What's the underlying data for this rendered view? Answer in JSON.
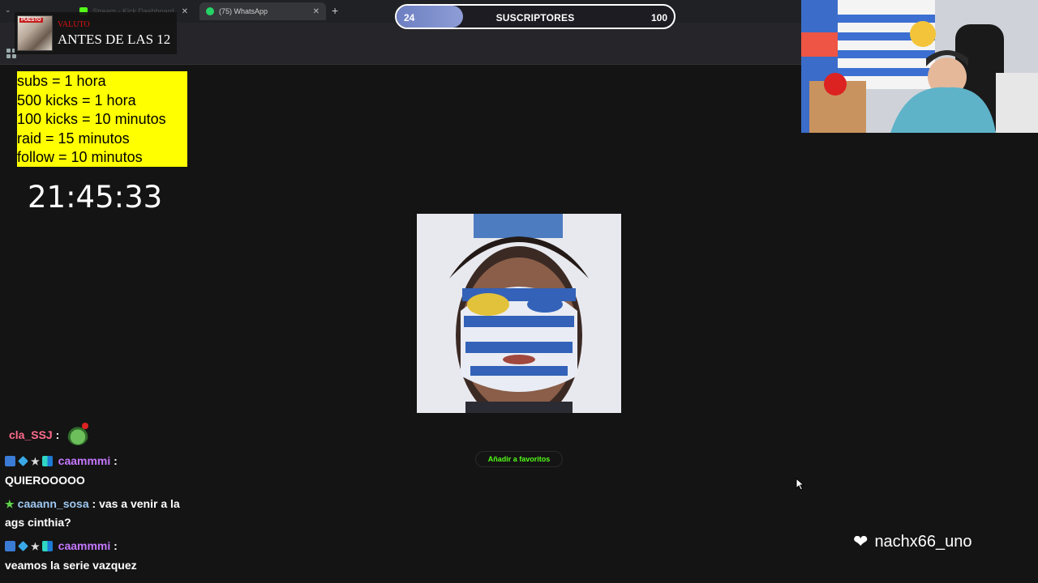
{
  "browser": {
    "tabs": [
      {
        "label": "Stream - Kick Dashboard"
      },
      {
        "label": "(75) WhatsApp"
      }
    ],
    "new_tab": "+"
  },
  "now_playing": {
    "album_badge": "PUESTO",
    "artist": "VALUTO",
    "song": "ANTES DE LAS 12"
  },
  "sub_goal": {
    "current": "24",
    "label": "SUSCRIPTORES",
    "target": "100",
    "progress_fraction": 0.24
  },
  "rules": [
    "subs = 1 hora",
    "500 kicks = 1 hora",
    "100 kicks = 10 minutos",
    "raid = 15 minutos",
    "follow = 10 minutos"
  ],
  "timer": "21:45:33",
  "favorites_button": "Añadir a favoritos",
  "chat": [
    {
      "user": "cla_SSJ",
      "separator": " :",
      "text": "",
      "user_color": "#ff6b8b",
      "emote": "sticker-emote"
    },
    {
      "user": "caammmi",
      "separator": " :",
      "text": "QUIEROOOOO",
      "user_color": "#c678ff",
      "badges": [
        "kick-badge",
        "cube-badge",
        "star-badge",
        "grid-badge"
      ]
    },
    {
      "user": "caaann_sosa",
      "separator": " :",
      "text": "vas a venir a la ags cinthia?",
      "user_color": "#9ec7f0",
      "badges": [
        "star-badge"
      ]
    },
    {
      "user": "caammmi",
      "separator": " :",
      "text": "veamos la serie vazquez",
      "user_color": "#c678ff",
      "badges": [
        "kick-badge",
        "cube-badge",
        "star-badge",
        "grid-badge"
      ]
    }
  ],
  "latest_follower": "nachx66_uno",
  "colors": {
    "kick_green": "#53fc18",
    "rules_bg": "#ffff00",
    "sub_fill": "#8e9dd6"
  }
}
